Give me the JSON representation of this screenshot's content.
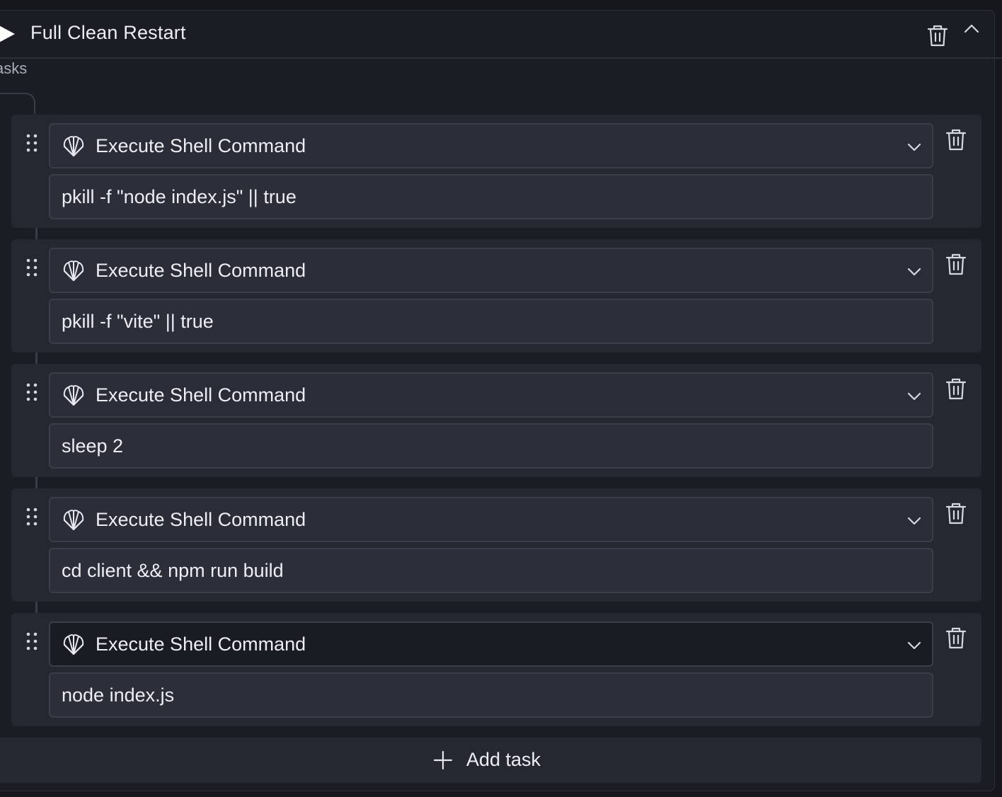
{
  "header": {
    "title": "Full Clean Restart",
    "play_icon": "play-icon",
    "delete_icon": "trash-icon",
    "collapse_icon": "chevron-up-icon"
  },
  "section": {
    "label": "Tasks"
  },
  "tasks": [
    {
      "type_label": "Execute Shell Command",
      "command": "pkill -f \"node index.js\" || true",
      "icon": "shell-icon"
    },
    {
      "type_label": "Execute Shell Command",
      "command": "pkill -f \"vite\" || true",
      "icon": "shell-icon"
    },
    {
      "type_label": "Execute Shell Command",
      "command": "sleep 2",
      "icon": "shell-icon"
    },
    {
      "type_label": "Execute Shell Command",
      "command": "cd client && npm run build",
      "icon": "shell-icon"
    },
    {
      "type_label": "Execute Shell Command",
      "command": "node index.js",
      "icon": "shell-icon"
    }
  ],
  "add_task": {
    "label": "Add task",
    "icon": "plus-icon"
  },
  "colors": {
    "background": "#15171d",
    "panel": "#1b1d24",
    "card": "#252831",
    "text": "#eceef3",
    "muted": "#a8acb8"
  }
}
